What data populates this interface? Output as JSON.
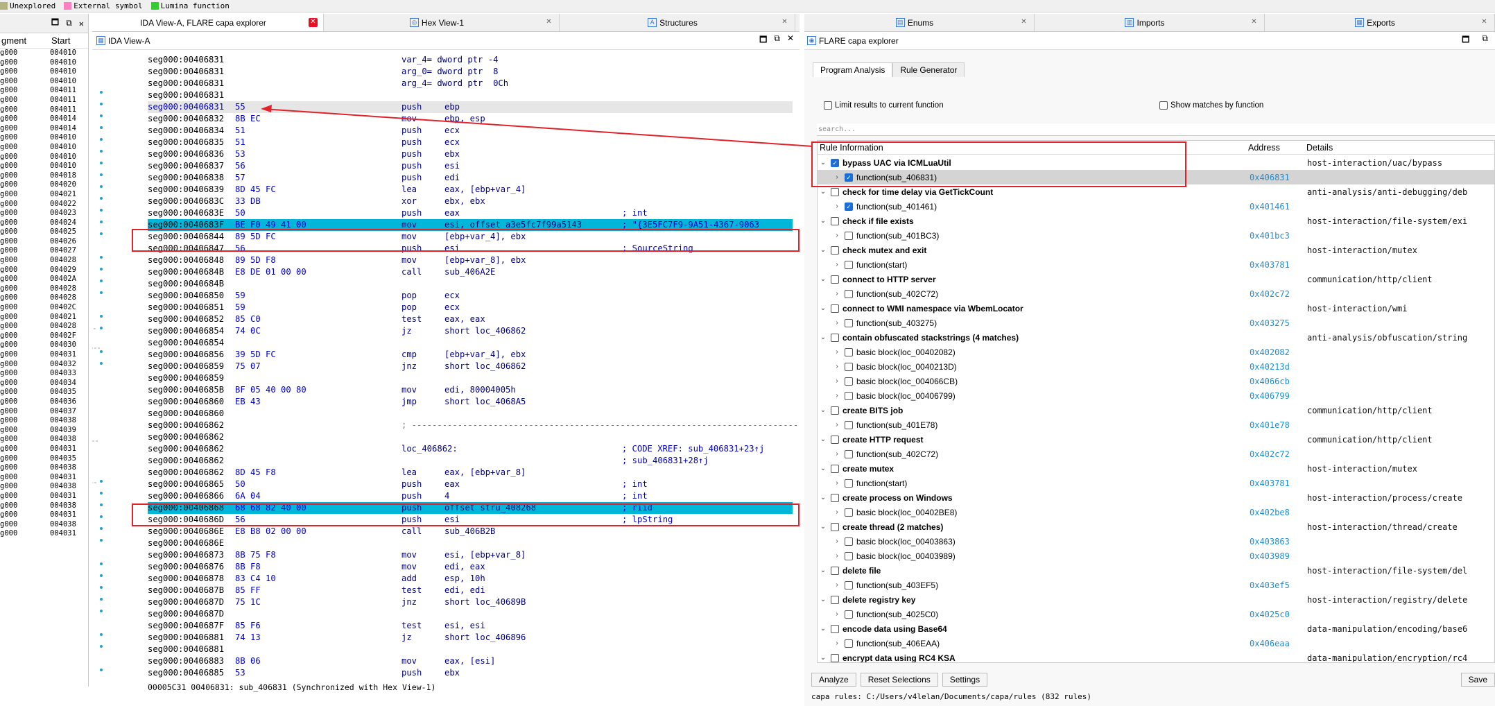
{
  "legend": [
    {
      "label": "Unexplored",
      "color": "#b4b480"
    },
    {
      "label": "External symbol",
      "color": "#ff80c0"
    },
    {
      "label": "Lumina function",
      "color": "#33cc33"
    }
  ],
  "segments": {
    "headers": [
      "gment",
      "Start"
    ],
    "rows": [
      [
        "g000",
        "004010"
      ],
      [
        "g000",
        "004010"
      ],
      [
        "g000",
        "004010"
      ],
      [
        "g000",
        "004010"
      ],
      [
        "g000",
        "004011"
      ],
      [
        "g000",
        "004011"
      ],
      [
        "g000",
        "004011"
      ],
      [
        "g000",
        "004014"
      ],
      [
        "g000",
        "004014"
      ],
      [
        "g000",
        "004010"
      ],
      [
        "g000",
        "004010"
      ],
      [
        "g000",
        "004010"
      ],
      [
        "g000",
        "004010"
      ],
      [
        "g000",
        "004018"
      ],
      [
        "g000",
        "004020"
      ],
      [
        "g000",
        "004021"
      ],
      [
        "g000",
        "004022"
      ],
      [
        "g000",
        "004023"
      ],
      [
        "g000",
        "004024"
      ],
      [
        "g000",
        "004025"
      ],
      [
        "g000",
        "004026"
      ],
      [
        "g000",
        "004027"
      ],
      [
        "g000",
        "004028"
      ],
      [
        "g000",
        "004029"
      ],
      [
        "g000",
        "00402A"
      ],
      [
        "g000",
        "004028"
      ],
      [
        "g000",
        "004028"
      ],
      [
        "g000",
        "00402C"
      ],
      [
        "g000",
        "004021"
      ],
      [
        "g000",
        "004028"
      ],
      [
        "g000",
        "00402F"
      ],
      [
        "g000",
        "004030"
      ],
      [
        "g000",
        "004031"
      ],
      [
        "g000",
        "004032"
      ],
      [
        "g000",
        "004033"
      ],
      [
        "g000",
        "004034"
      ],
      [
        "g000",
        "004035"
      ],
      [
        "g000",
        "004036"
      ],
      [
        "g000",
        "004037"
      ],
      [
        "g000",
        "004038"
      ],
      [
        "g000",
        "004039"
      ],
      [
        "g000",
        "004038"
      ],
      [
        "g000",
        "004031"
      ],
      [
        "g000",
        "004035"
      ],
      [
        "g000",
        "004038"
      ],
      [
        "g000",
        "004031"
      ],
      [
        "g000",
        "004038"
      ],
      [
        "g000",
        "004031"
      ],
      [
        "g000",
        "004038"
      ],
      [
        "g000",
        "004031"
      ],
      [
        "g000",
        "004038"
      ],
      [
        "g000",
        "004031"
      ]
    ]
  },
  "tabs": {
    "left": [
      {
        "label": "IDA View-A, FLARE capa explorer",
        "active": true
      },
      {
        "label": "Hex View-1",
        "active": false
      },
      {
        "label": "Structures",
        "active": false
      }
    ],
    "right": [
      {
        "label": "Enums"
      },
      {
        "label": "Imports"
      },
      {
        "label": "Exports"
      }
    ]
  },
  "ida": {
    "title": "IDA View-A",
    "lines": [
      {
        "seg": "seg000:00406831",
        "bytes": "",
        "mn": "var_4= dword ptr -4",
        "op": "",
        "cm": ""
      },
      {
        "seg": "seg000:00406831",
        "bytes": "",
        "mn": "arg_0= dword ptr  8",
        "op": "",
        "cm": ""
      },
      {
        "seg": "seg000:00406831",
        "bytes": "",
        "mn": "arg_4= dword ptr  0Ch",
        "op": "",
        "cm": ""
      },
      {
        "seg": "seg000:00406831",
        "bytes": "",
        "mn": "",
        "op": "",
        "cm": ""
      },
      {
        "seg": "seg000:00406831",
        "bytes": "55",
        "mn": "push",
        "op": "ebp",
        "cm": "",
        "cls": "cur"
      },
      {
        "seg": "seg000:00406832",
        "bytes": "8B EC",
        "mn": "mov",
        "op": "ebp, esp",
        "cm": ""
      },
      {
        "seg": "seg000:00406834",
        "bytes": "51",
        "mn": "push",
        "op": "ecx",
        "cm": ""
      },
      {
        "seg": "seg000:00406835",
        "bytes": "51",
        "mn": "push",
        "op": "ecx",
        "cm": ""
      },
      {
        "seg": "seg000:00406836",
        "bytes": "53",
        "mn": "push",
        "op": "ebx",
        "cm": ""
      },
      {
        "seg": "seg000:00406837",
        "bytes": "56",
        "mn": "push",
        "op": "esi",
        "cm": ""
      },
      {
        "seg": "seg000:00406838",
        "bytes": "57",
        "mn": "push",
        "op": "edi",
        "cm": ""
      },
      {
        "seg": "seg000:00406839",
        "bytes": "8D 45 FC",
        "mn": "lea",
        "op": "eax, [ebp+var_4]",
        "cm": ""
      },
      {
        "seg": "seg000:0040683C",
        "bytes": "33 DB",
        "mn": "xor",
        "op": "ebx, ebx",
        "cm": ""
      },
      {
        "seg": "seg000:0040683E",
        "bytes": "50",
        "mn": "push",
        "op": "eax",
        "cm": "; int"
      },
      {
        "seg": "seg000:0040683F",
        "bytes": "BE F0 49 41 00",
        "mn": "mov",
        "op": "esi, offset a3e5fc7f99a5143",
        "cm": "; \"{3E5FC7F9-9A51-4367-9063",
        "cls": "hl"
      },
      {
        "seg": "seg000:00406844",
        "bytes": "89 5D FC",
        "mn": "mov",
        "op": "[ebp+var_4], ebx",
        "cm": ""
      },
      {
        "seg": "seg000:00406847",
        "bytes": "56",
        "mn": "push",
        "op": "esi",
        "cm": "; SourceString"
      },
      {
        "seg": "seg000:00406848",
        "bytes": "89 5D F8",
        "mn": "mov",
        "op": "[ebp+var_8], ebx",
        "cm": ""
      },
      {
        "seg": "seg000:0040684B",
        "bytes": "E8 DE 01 00 00",
        "mn": "call",
        "op": "sub_406A2E",
        "cm": ""
      },
      {
        "seg": "seg000:0040684B",
        "bytes": "",
        "mn": "",
        "op": "",
        "cm": ""
      },
      {
        "seg": "seg000:00406850",
        "bytes": "59",
        "mn": "pop",
        "op": "ecx",
        "cm": ""
      },
      {
        "seg": "seg000:00406851",
        "bytes": "59",
        "mn": "pop",
        "op": "ecx",
        "cm": ""
      },
      {
        "seg": "seg000:00406852",
        "bytes": "85 C0",
        "mn": "test",
        "op": "eax, eax",
        "cm": ""
      },
      {
        "seg": "seg000:00406854",
        "bytes": "74 0C",
        "mn": "jz",
        "op": "short loc_406862",
        "cm": ""
      },
      {
        "seg": "seg000:00406854",
        "bytes": "",
        "mn": "",
        "op": "",
        "cm": ""
      },
      {
        "seg": "seg000:00406856",
        "bytes": "39 5D FC",
        "mn": "cmp",
        "op": "[ebp+var_4], ebx",
        "cm": ""
      },
      {
        "seg": "seg000:00406859",
        "bytes": "75 07",
        "mn": "jnz",
        "op": "short loc_406862",
        "cm": ""
      },
      {
        "seg": "seg000:00406859",
        "bytes": "",
        "mn": "",
        "op": "",
        "cm": ""
      },
      {
        "seg": "seg000:0040685B",
        "bytes": "BF 05 40 00 80",
        "mn": "mov",
        "op": "edi, 80004005h",
        "cm": ""
      },
      {
        "seg": "seg000:00406860",
        "bytes": "EB 43",
        "mn": "jmp",
        "op": "short loc_4068A5",
        "cm": ""
      },
      {
        "seg": "seg000:00406860",
        "bytes": "",
        "mn": "",
        "op": "",
        "cm": ""
      },
      {
        "seg": "seg000:00406862",
        "bytes": "",
        "mn": "; -------------------------------------------------------------------------------------------",
        "op": "",
        "cm": "",
        "gray": true
      },
      {
        "seg": "seg000:00406862",
        "bytes": "",
        "mn": "",
        "op": "",
        "cm": ""
      },
      {
        "seg": "seg000:00406862",
        "bytes": "",
        "mn": "loc_406862:",
        "op": "",
        "cm": "; CODE XREF: sub_406831+23↑j"
      },
      {
        "seg": "seg000:00406862",
        "bytes": "",
        "mn": "",
        "op": "",
        "cm": "; sub_406831+28↑j"
      },
      {
        "seg": "seg000:00406862",
        "bytes": "8D 45 F8",
        "mn": "lea",
        "op": "eax, [ebp+var_8]",
        "cm": ""
      },
      {
        "seg": "seg000:00406865",
        "bytes": "50",
        "mn": "push",
        "op": "eax",
        "cm": "; int"
      },
      {
        "seg": "seg000:00406866",
        "bytes": "6A 04",
        "mn": "push",
        "op": "4",
        "cm": "; int"
      },
      {
        "seg": "seg000:00406868",
        "bytes": "68 68 82 40 00",
        "mn": "push",
        "op": "offset stru_408268",
        "cm": "; riid",
        "cls": "hl"
      },
      {
        "seg": "seg000:0040686D",
        "bytes": "56",
        "mn": "push",
        "op": "esi",
        "cm": "; lpString"
      },
      {
        "seg": "seg000:0040686E",
        "bytes": "E8 B8 02 00 00",
        "mn": "call",
        "op": "sub_406B2B",
        "cm": ""
      },
      {
        "seg": "seg000:0040686E",
        "bytes": "",
        "mn": "",
        "op": "",
        "cm": ""
      },
      {
        "seg": "seg000:00406873",
        "bytes": "8B 75 F8",
        "mn": "mov",
        "op": "esi, [ebp+var_8]",
        "cm": ""
      },
      {
        "seg": "seg000:00406876",
        "bytes": "8B F8",
        "mn": "mov",
        "op": "edi, eax",
        "cm": ""
      },
      {
        "seg": "seg000:00406878",
        "bytes": "83 C4 10",
        "mn": "add",
        "op": "esp, 10h",
        "cm": ""
      },
      {
        "seg": "seg000:0040687B",
        "bytes": "85 FF",
        "mn": "test",
        "op": "edi, edi",
        "cm": ""
      },
      {
        "seg": "seg000:0040687D",
        "bytes": "75 1C",
        "mn": "jnz",
        "op": "short loc_40689B",
        "cm": ""
      },
      {
        "seg": "seg000:0040687D",
        "bytes": "",
        "mn": "",
        "op": "",
        "cm": ""
      },
      {
        "seg": "seg000:0040687F",
        "bytes": "85 F6",
        "mn": "test",
        "op": "esi, esi",
        "cm": ""
      },
      {
        "seg": "seg000:00406881",
        "bytes": "74 13",
        "mn": "jz",
        "op": "short loc_406896",
        "cm": ""
      },
      {
        "seg": "seg000:00406881",
        "bytes": "",
        "mn": "",
        "op": "",
        "cm": ""
      },
      {
        "seg": "seg000:00406883",
        "bytes": "8B 06",
        "mn": "mov",
        "op": "eax, [esi]",
        "cm": ""
      },
      {
        "seg": "seg000:00406885",
        "bytes": "53",
        "mn": "push",
        "op": "ebx",
        "cm": ""
      }
    ],
    "status": "00005C31 00406831: sub_406831 (Synchronized with Hex View-1)"
  },
  "capa": {
    "title": "FLARE capa explorer",
    "subtabs": [
      "Program Analysis",
      "Rule Generator"
    ],
    "opt_limit": "Limit results to current function",
    "opt_show": "Show matches by function",
    "search_placeholder": "search...",
    "headers": [
      "Rule Information",
      "Address",
      "Details"
    ],
    "rows": [
      {
        "lvl": 0,
        "open": true,
        "checked": true,
        "name": "bypass UAC via ICMLuaUtil",
        "addr": "",
        "det": "host-interaction/uac/bypass",
        "bold": true
      },
      {
        "lvl": 1,
        "open": false,
        "checked": true,
        "name": "function(sub_406831)",
        "addr": "0x406831",
        "det": "",
        "sel": true
      },
      {
        "lvl": 0,
        "open": true,
        "checked": false,
        "name": "check for time delay via GetTickCount",
        "addr": "",
        "det": "anti-analysis/anti-debugging/deb",
        "bold": true
      },
      {
        "lvl": 1,
        "open": false,
        "checked": true,
        "name": "function(sub_401461)",
        "addr": "0x401461",
        "det": ""
      },
      {
        "lvl": 0,
        "open": true,
        "checked": false,
        "name": "check if file exists",
        "addr": "",
        "det": "host-interaction/file-system/exi",
        "bold": true
      },
      {
        "lvl": 1,
        "open": false,
        "checked": false,
        "name": "function(sub_401BC3)",
        "addr": "0x401bc3",
        "det": ""
      },
      {
        "lvl": 0,
        "open": true,
        "checked": false,
        "name": "check mutex and exit",
        "addr": "",
        "det": "host-interaction/mutex",
        "bold": true
      },
      {
        "lvl": 1,
        "open": false,
        "checked": false,
        "name": "function(start)",
        "addr": "0x403781",
        "det": ""
      },
      {
        "lvl": 0,
        "open": true,
        "checked": false,
        "name": "connect to HTTP server",
        "addr": "",
        "det": "communication/http/client",
        "bold": true
      },
      {
        "lvl": 1,
        "open": false,
        "checked": false,
        "name": "function(sub_402C72)",
        "addr": "0x402c72",
        "det": ""
      },
      {
        "lvl": 0,
        "open": true,
        "checked": false,
        "name": "connect to WMI namespace via WbemLocator",
        "addr": "",
        "det": "host-interaction/wmi",
        "bold": true
      },
      {
        "lvl": 1,
        "open": false,
        "checked": false,
        "name": "function(sub_403275)",
        "addr": "0x403275",
        "det": ""
      },
      {
        "lvl": 0,
        "open": true,
        "checked": false,
        "name": "contain obfuscated stackstrings (4 matches)",
        "addr": "",
        "det": "anti-analysis/obfuscation/string",
        "bold": true
      },
      {
        "lvl": 1,
        "open": false,
        "checked": false,
        "name": "basic block(loc_00402082)",
        "addr": "0x402082",
        "det": ""
      },
      {
        "lvl": 1,
        "open": false,
        "checked": false,
        "name": "basic block(loc_0040213D)",
        "addr": "0x40213d",
        "det": ""
      },
      {
        "lvl": 1,
        "open": false,
        "checked": false,
        "name": "basic block(loc_004066CB)",
        "addr": "0x4066cb",
        "det": ""
      },
      {
        "lvl": 1,
        "open": false,
        "checked": false,
        "name": "basic block(loc_00406799)",
        "addr": "0x406799",
        "det": ""
      },
      {
        "lvl": 0,
        "open": true,
        "checked": false,
        "name": "create BITS job",
        "addr": "",
        "det": "communication/http/client",
        "bold": true
      },
      {
        "lvl": 1,
        "open": false,
        "checked": false,
        "name": "function(sub_401E78)",
        "addr": "0x401e78",
        "det": ""
      },
      {
        "lvl": 0,
        "open": true,
        "checked": false,
        "name": "create HTTP request",
        "addr": "",
        "det": "communication/http/client",
        "bold": true
      },
      {
        "lvl": 1,
        "open": false,
        "checked": false,
        "name": "function(sub_402C72)",
        "addr": "0x402c72",
        "det": ""
      },
      {
        "lvl": 0,
        "open": true,
        "checked": false,
        "name": "create mutex",
        "addr": "",
        "det": "host-interaction/mutex",
        "bold": true
      },
      {
        "lvl": 1,
        "open": false,
        "checked": false,
        "name": "function(start)",
        "addr": "0x403781",
        "det": ""
      },
      {
        "lvl": 0,
        "open": true,
        "checked": false,
        "name": "create process on Windows",
        "addr": "",
        "det": "host-interaction/process/create",
        "bold": true
      },
      {
        "lvl": 1,
        "open": false,
        "checked": false,
        "name": "basic block(loc_00402BE8)",
        "addr": "0x402be8",
        "det": ""
      },
      {
        "lvl": 0,
        "open": true,
        "checked": false,
        "name": "create thread (2 matches)",
        "addr": "",
        "det": "host-interaction/thread/create",
        "bold": true
      },
      {
        "lvl": 1,
        "open": false,
        "checked": false,
        "name": "basic block(loc_00403863)",
        "addr": "0x403863",
        "det": ""
      },
      {
        "lvl": 1,
        "open": false,
        "checked": false,
        "name": "basic block(loc_00403989)",
        "addr": "0x403989",
        "det": ""
      },
      {
        "lvl": 0,
        "open": true,
        "checked": false,
        "name": "delete file",
        "addr": "",
        "det": "host-interaction/file-system/del",
        "bold": true
      },
      {
        "lvl": 1,
        "open": false,
        "checked": false,
        "name": "function(sub_403EF5)",
        "addr": "0x403ef5",
        "det": ""
      },
      {
        "lvl": 0,
        "open": true,
        "checked": false,
        "name": "delete registry key",
        "addr": "",
        "det": "host-interaction/registry/delete",
        "bold": true
      },
      {
        "lvl": 1,
        "open": false,
        "checked": false,
        "name": "function(sub_4025C0)",
        "addr": "0x4025c0",
        "det": ""
      },
      {
        "lvl": 0,
        "open": true,
        "checked": false,
        "name": "encode data using Base64",
        "addr": "",
        "det": "data-manipulation/encoding/base6",
        "bold": true
      },
      {
        "lvl": 1,
        "open": false,
        "checked": false,
        "name": "function(sub_406EAA)",
        "addr": "0x406eaa",
        "det": ""
      },
      {
        "lvl": 0,
        "open": true,
        "checked": false,
        "name": "encrypt data using RC4 KSA",
        "addr": "",
        "det": "data-manipulation/encryption/rc4",
        "bold": true
      }
    ],
    "buttons": {
      "analyze": "Analyze",
      "reset": "Reset Selections",
      "settings": "Settings",
      "save": "Save"
    },
    "rules_line": "capa rules: C:/Users/v4lelan/Documents/capa/rules (832 rules)"
  }
}
